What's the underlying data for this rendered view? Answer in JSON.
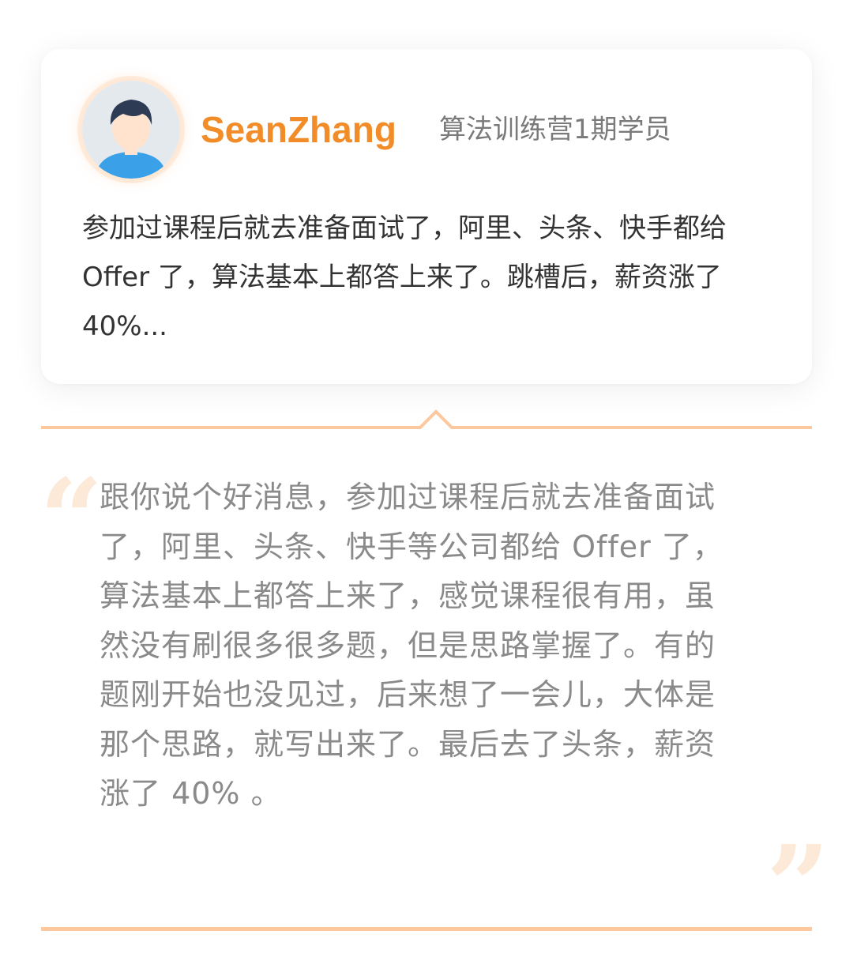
{
  "profile": {
    "avatar_icon": "user-avatar-icon",
    "name": "SeanZhang",
    "tag": "算法训练营1期学员"
  },
  "summary": "参加过课程后就去准备面试了，阿里、头条、快手都给 Offer 了，算法基本上都答上来了。跳槽后，薪资涨了 40%...",
  "testimonial": {
    "open_quote": "“",
    "close_quote": "”",
    "text": "跟你说个好消息，参加过课程后就去准备面试了，阿里、头条、快手等公司都给 Offer 了，算法基本上都答上来了，感觉课程很有用，虽然没有刷很多很多题，但是思路掌握了。有的题刚开始也没见过，后来想了一会儿，大体是那个思路，就写出来了。最后去了头条，薪资涨了 40% 。"
  },
  "colors": {
    "accent": "#f28c28",
    "divider": "#fdc89e",
    "quote_mark": "#fde9d7"
  }
}
